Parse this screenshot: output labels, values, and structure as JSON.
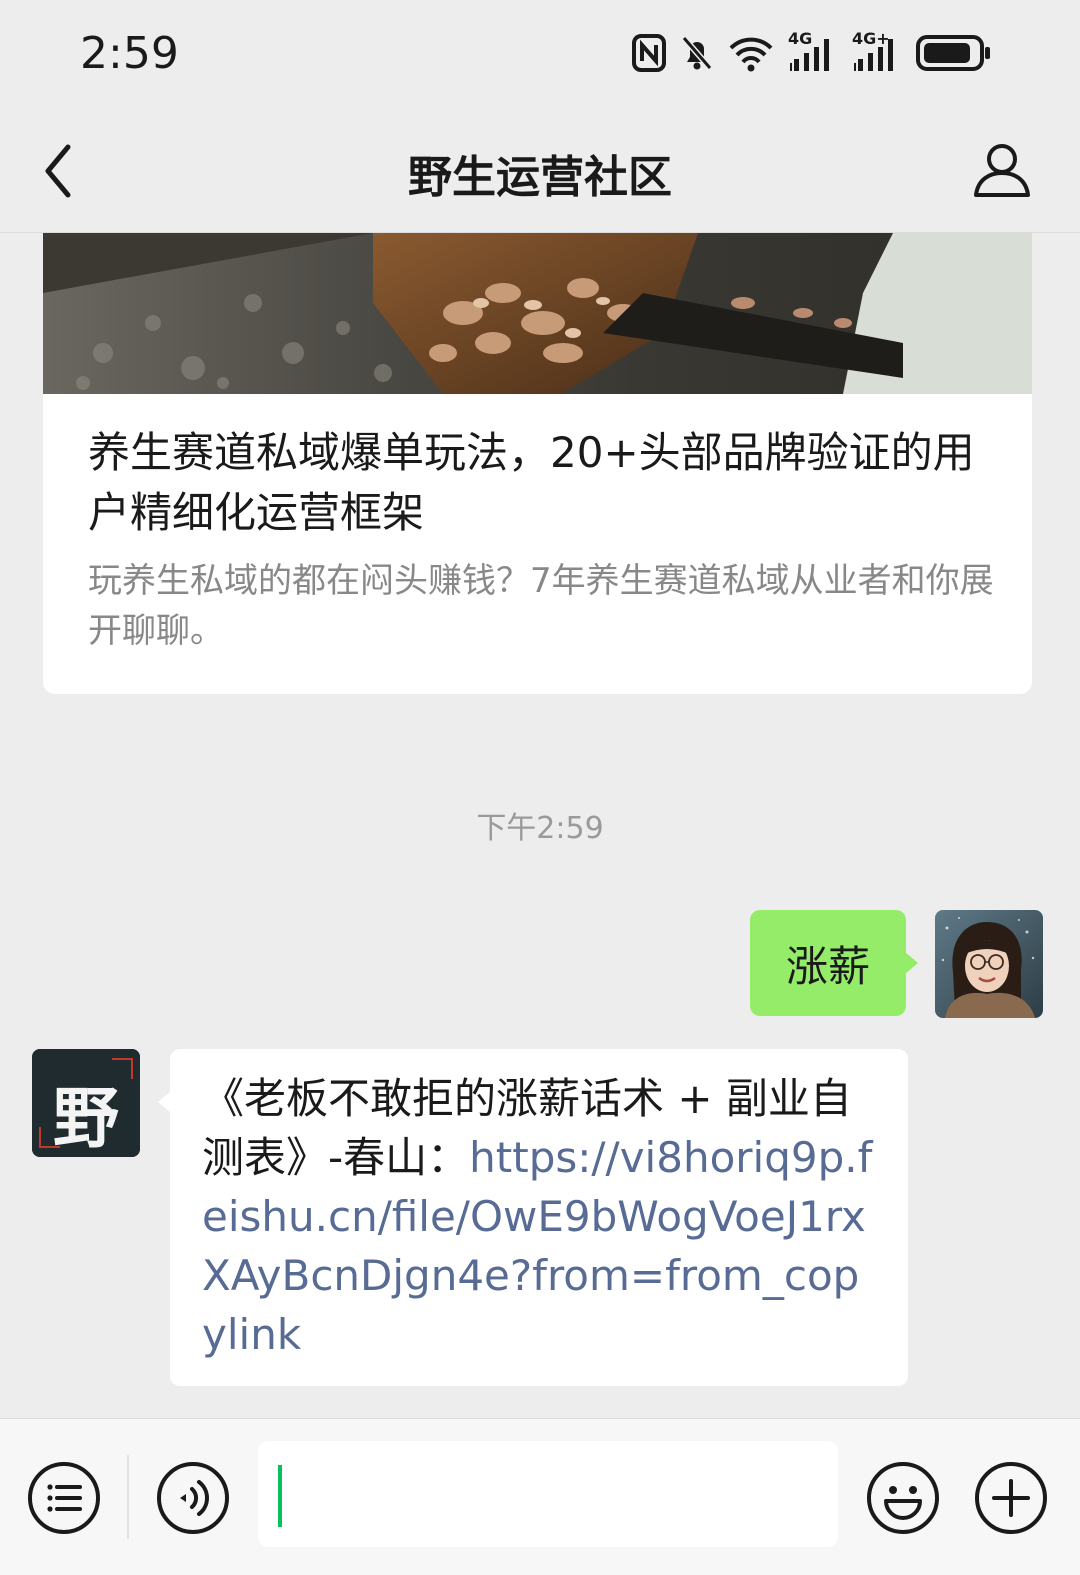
{
  "status_bar": {
    "time": "2:59",
    "signal_1_label": "4G",
    "signal_2_label": "4G+",
    "icons": [
      "nfc-icon",
      "mute-bell-icon",
      "wifi-icon",
      "signal-4g-icon",
      "signal-4g-plus-icon",
      "battery-icon"
    ]
  },
  "nav": {
    "title": "野生运营社区",
    "back_icon": "chevron-left-icon",
    "profile_icon": "person-icon"
  },
  "article": {
    "title": "养生赛道私域爆单玩法，20+头部品牌验证的用户精细化运营框架",
    "description": "玩养生私域的都在闷头赚钱？7年养生赛道私域从业者和你展开聊聊。"
  },
  "chat": {
    "timestamp": "下午2:59",
    "sent_message": "涨薪",
    "received_text": "《老板不敢拒的涨薪话术 + 副业自测表》-春山：",
    "received_link": "https://vi8horiq9p.feishu.cn/file/OwE9bWogVoeJ1rxXAyBcnDjgn4e?from=from_copylink",
    "brand_avatar_char": "野"
  },
  "input_bar": {
    "icons": [
      "menu-list-icon",
      "voice-icon",
      "emoji-icon",
      "plus-icon"
    ],
    "input_value": ""
  },
  "colors": {
    "background": "#ededed",
    "sent_bubble": "#95ec69",
    "link": "#576b95",
    "cursor": "#07c160"
  }
}
